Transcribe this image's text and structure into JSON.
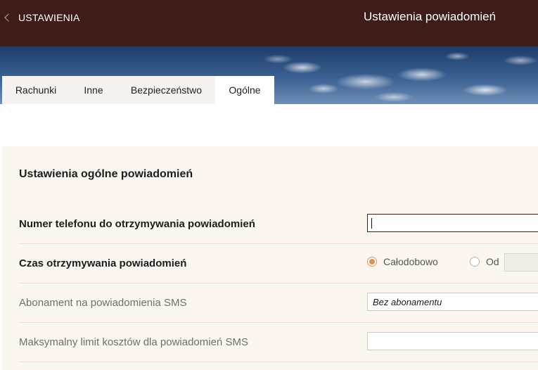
{
  "header": {
    "back_label": "USTAWIENIA",
    "title": "Ustawienia powiadomień"
  },
  "tabs": [
    {
      "label": "Rachunki",
      "active": false
    },
    {
      "label": "Inne",
      "active": false
    },
    {
      "label": "Bezpieczeństwo",
      "active": false
    },
    {
      "label": "Ogólne",
      "active": true
    }
  ],
  "section": {
    "title": "Ustawienia ogólne powiadomień",
    "phone": {
      "label": "Numer telefonu do otrzymywania powiadomień",
      "value": ""
    },
    "time": {
      "label": "Czas otrzymywania powiadomień",
      "options": [
        {
          "label": "Całodobowo",
          "selected": true
        },
        {
          "label": "Od",
          "selected": false
        }
      ]
    },
    "sms_subscription": {
      "label": "Abonament na powiadomienia SMS",
      "value": "Bez abonamentu"
    },
    "sms_limit": {
      "label": "Maksymalny limit kosztów dla powiadomień SMS",
      "value": ""
    }
  },
  "colors": {
    "header_bg": "#3e1c17",
    "panel_bg": "#fcf6f0",
    "accent": "#e3904f"
  }
}
